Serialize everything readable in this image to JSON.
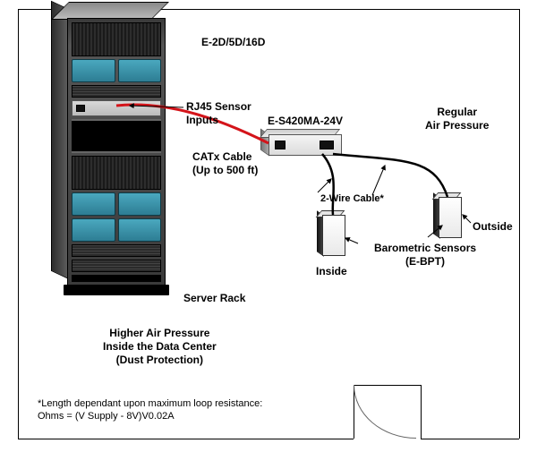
{
  "labels": {
    "device_model": "E-2D/5D/16D",
    "rj45": "RJ45 Sensor\nInputs",
    "converter_model": "E-S420MA-24V",
    "regular_pressure": "Regular\nAir Pressure",
    "catx": "CATx Cable\n(Up to 500 ft)",
    "two_wire": "2-Wire Cable*",
    "inside": "Inside",
    "outside": "Outside",
    "barometric": "Barometric Sensors\n(E-BPT)",
    "server_rack": "Server Rack",
    "higher_pressure": "Higher Air Pressure\nInside the Data Center\n(Dust Protection)",
    "footnote": "*Length dependant upon maximum loop resistance:\nOhms = (V Supply - 8V)V0.02A"
  },
  "cables": {
    "catx_color": "#d4141a",
    "wire_color": "#000000"
  },
  "components": {
    "rack_model": "E-2D/5D/16D",
    "converter": "E-S420MA-24V",
    "sensor_model": "E-BPT",
    "catx_max_length_ft": 500
  }
}
